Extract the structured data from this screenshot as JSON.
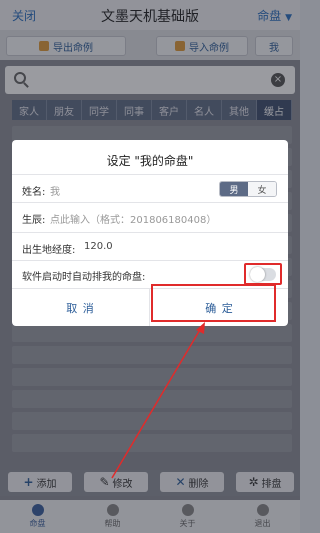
{
  "header": {
    "close_label": "关闭",
    "title": "文墨天机基础版",
    "menu_label": "命盘",
    "menu_caret": "▼"
  },
  "toolbar": {
    "export_label": "导出命例",
    "import_label": "导入命例",
    "mine_label": "我"
  },
  "tabs": [
    {
      "label": "家人"
    },
    {
      "label": "朋友"
    },
    {
      "label": "同学"
    },
    {
      "label": "同事"
    },
    {
      "label": "客户"
    },
    {
      "label": "名人"
    },
    {
      "label": "其他"
    },
    {
      "label": "缓占",
      "active": true
    }
  ],
  "dialog": {
    "title": "设定 \"我的命盘\"",
    "name_label": "姓名:",
    "name_value": "我",
    "gender_male": "男",
    "gender_female": "女",
    "birth_label": "生辰:",
    "birth_placeholder": "点此输入（格式：201806180408）",
    "longitude_label": "出生地经度:",
    "longitude_value": "120.0",
    "autostart_label": "软件启动时自动排我的命盘:",
    "autostart_on": false,
    "cancel_label": "取 消",
    "ok_label": "确 定"
  },
  "bottom_tools": {
    "add_label": "添加",
    "edit_label": "修改",
    "delete_label": "删除",
    "sort_label": "排盘"
  },
  "navbar": [
    {
      "label": "命盘",
      "active": true
    },
    {
      "label": "帮助"
    },
    {
      "label": "关于"
    },
    {
      "label": "退出"
    }
  ],
  "colors": {
    "accent": "#2d5e99",
    "highlight": "#e02b2b",
    "tab_active": "#3e4f6e"
  }
}
